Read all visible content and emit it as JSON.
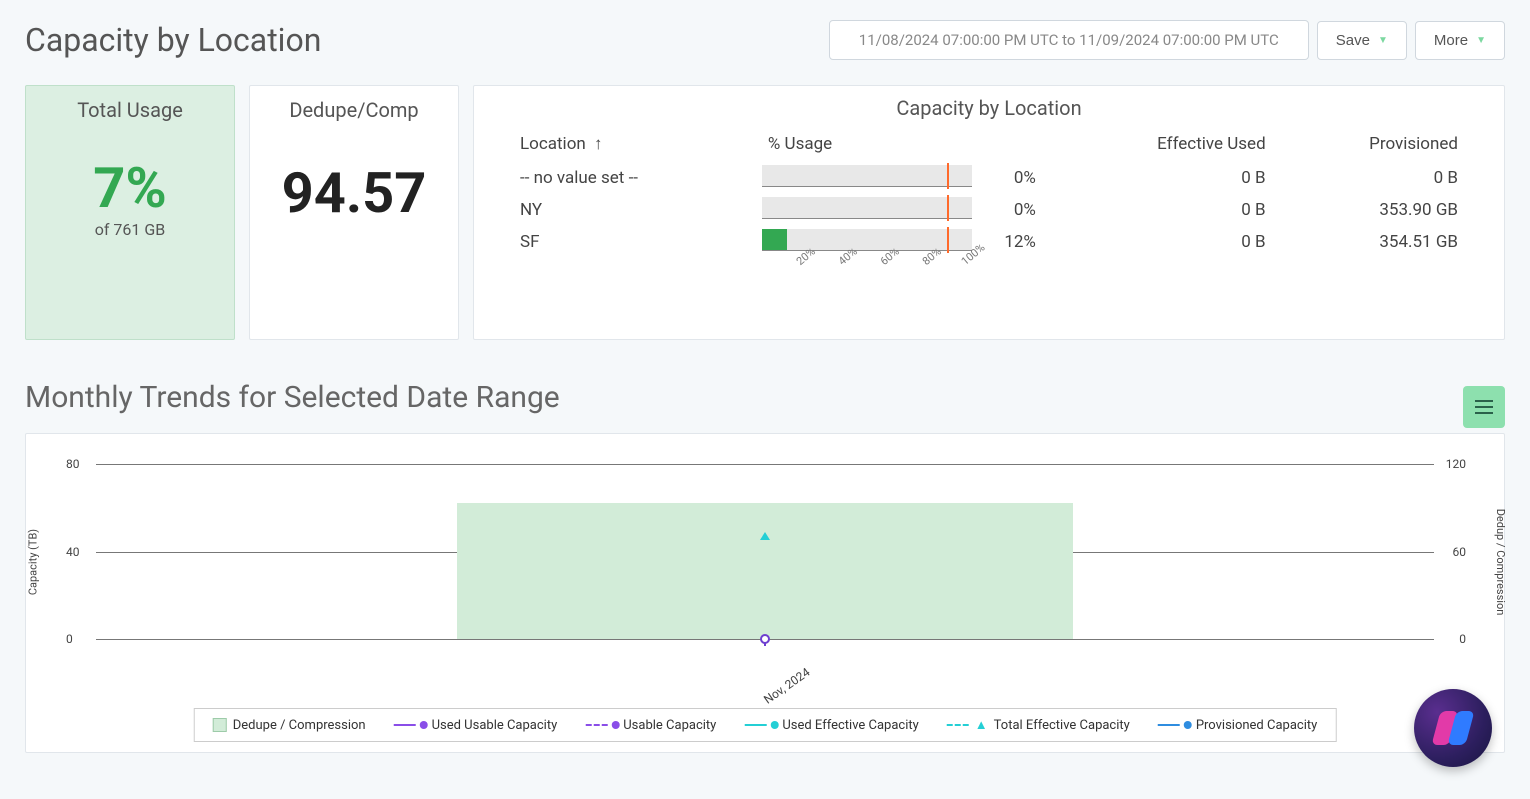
{
  "header": {
    "title": "Capacity by Location",
    "date_range": "11/08/2024 07:00:00 PM UTC to 11/09/2024 07:00:00 PM UTC",
    "save_label": "Save",
    "more_label": "More"
  },
  "kpi": {
    "total_usage": {
      "title": "Total Usage",
      "value": "7%",
      "sub": "of 761 GB"
    },
    "dedupe": {
      "title": "Dedupe/Comp",
      "value": "94.57"
    }
  },
  "table": {
    "title": "Capacity by Location",
    "columns": {
      "location": "Location",
      "usage": "% Usage",
      "effective": "Effective Used",
      "provisioned": "Provisioned"
    },
    "rows": [
      {
        "location": "-- no value set --",
        "usage_pct": 0,
        "usage_label": "0%",
        "marker": 88,
        "effective": "0 B",
        "provisioned": "0 B"
      },
      {
        "location": "NY",
        "usage_pct": 0,
        "usage_label": "0%",
        "marker": 88,
        "effective": "0 B",
        "provisioned": "353.90 GB"
      },
      {
        "location": "SF",
        "usage_pct": 12,
        "usage_label": "12%",
        "marker": 88,
        "effective": "0 B",
        "provisioned": "354.51 GB"
      }
    ],
    "axis_ticks": [
      "20%",
      "40%",
      "60%",
      "80%",
      "100%"
    ]
  },
  "trend": {
    "title": "Monthly Trends for Selected Date Range",
    "y_left_label": "Capacity (TB)",
    "y_right_label": "Dedup / Compression",
    "legend": [
      "Dedupe / Compression",
      "Used Usable Capacity",
      "Usable Capacity",
      "Used Effective Capacity",
      "Total Effective Capacity",
      "Provisioned Capacity"
    ]
  },
  "chart_data": {
    "type": "area",
    "title": "Monthly Trends for Selected Date Range",
    "xlabel": "",
    "ylabel_left": "Capacity (TB)",
    "ylabel_right": "Dedup / Compression",
    "x": [
      "Nov, 2024"
    ],
    "y_left_ticks": [
      0,
      40,
      80
    ],
    "y_right_ticks": [
      0,
      60,
      120
    ],
    "ylim_left": [
      0,
      80
    ],
    "ylim_right": [
      0,
      120
    ],
    "series": [
      {
        "name": "Dedupe / Compression",
        "axis": "right",
        "values": [
          94
        ]
      },
      {
        "name": "Used Usable Capacity",
        "axis": "left",
        "values": [
          0
        ]
      },
      {
        "name": "Usable Capacity",
        "axis": "left",
        "values": [
          0
        ]
      },
      {
        "name": "Used Effective Capacity",
        "axis": "left",
        "values": [
          0
        ]
      },
      {
        "name": "Total Effective Capacity",
        "axis": "left",
        "values": [
          45
        ]
      },
      {
        "name": "Provisioned Capacity",
        "axis": "left",
        "values": [
          0
        ]
      }
    ]
  }
}
